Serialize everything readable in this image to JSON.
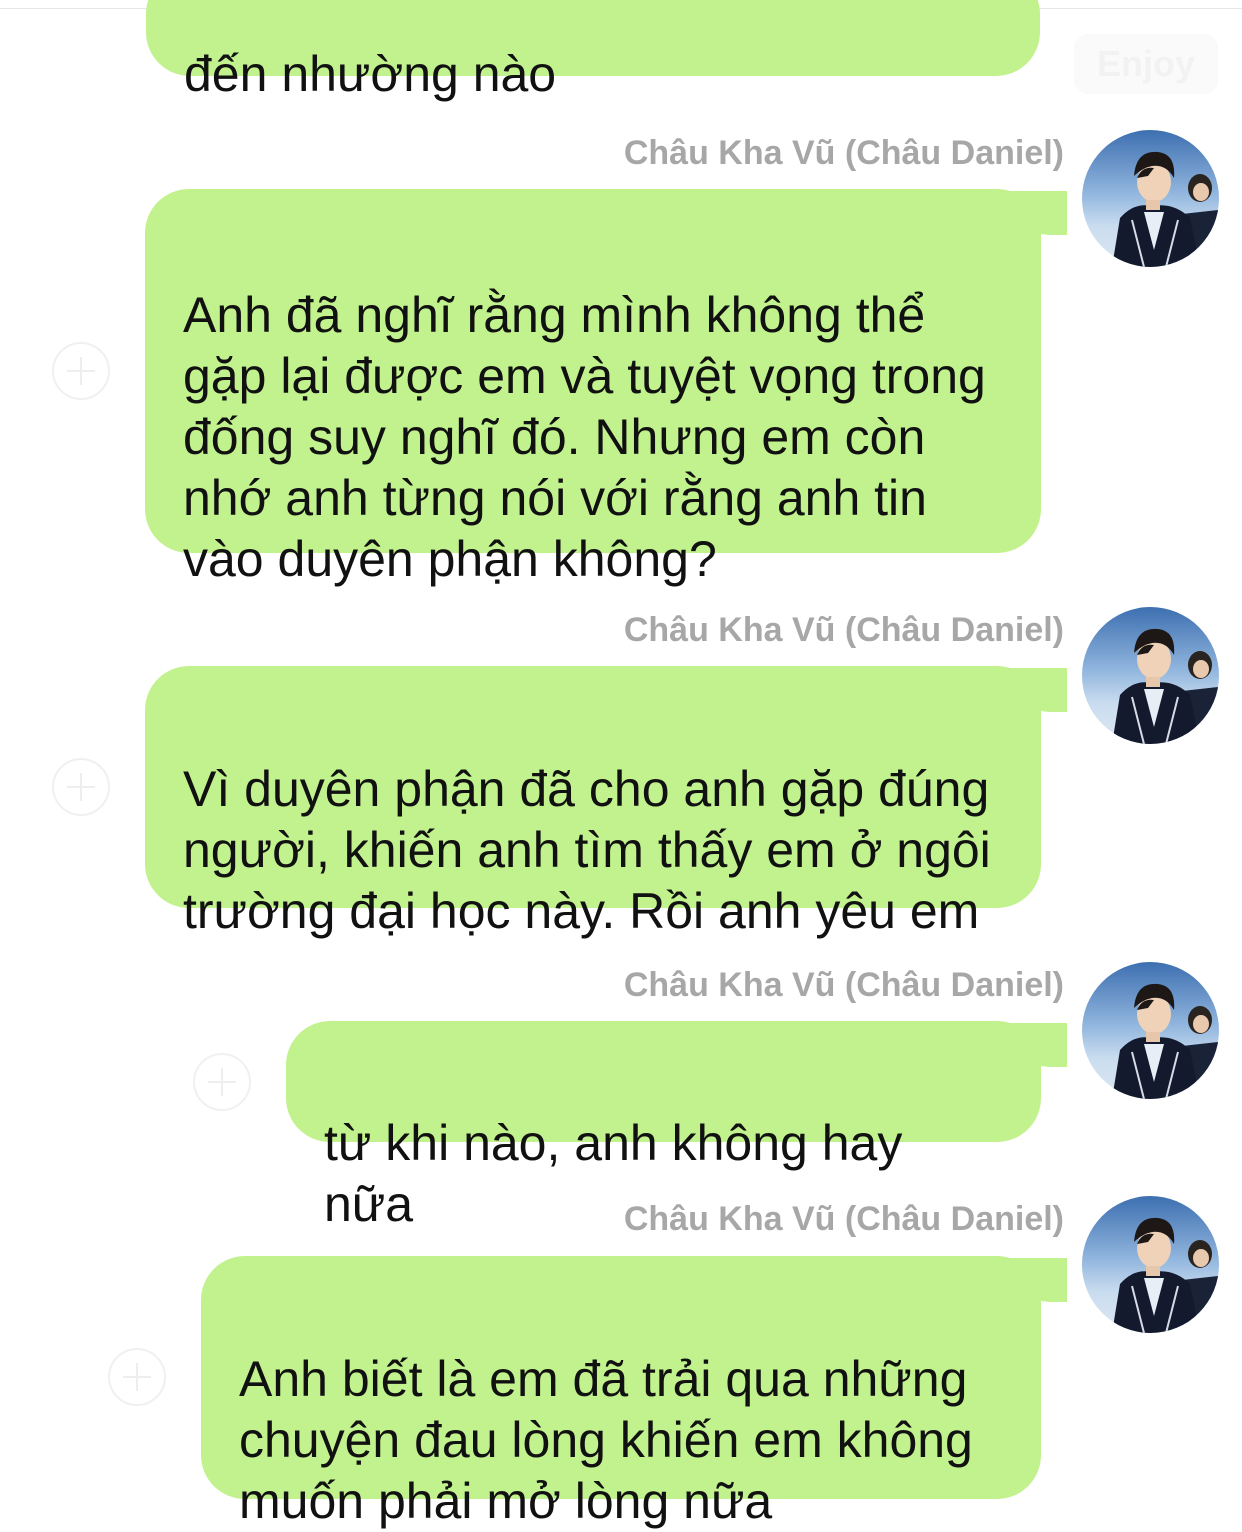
{
  "colors": {
    "bubble": "#c2f28e",
    "sender_name": "#a7a7a7",
    "background": "#ffffff"
  },
  "top_watermark": "Enjoy",
  "messages": [
    {
      "sender": "",
      "text": "đến nhường nào",
      "has_avatar": false
    },
    {
      "sender": "Châu Kha Vũ (Châu Daniel)",
      "text": "Anh đã nghĩ rằng mình không thể\ngặp lại được em và tuyệt vọng trong\nđống suy nghĩ đó. Nhưng em còn\nnhớ anh từng nói với rằng anh tin\nvào duyên phận không?",
      "has_avatar": true,
      "avatar_icon": "avatar-photo"
    },
    {
      "sender": "Châu Kha Vũ (Châu Daniel)",
      "text": "Vì duyên phận đã cho anh gặp đúng\nngười, khiến anh tìm thấy em ở ngôi\ntrường đại học này. Rồi anh yêu em",
      "has_avatar": true,
      "avatar_icon": "avatar-photo"
    },
    {
      "sender": "Châu Kha Vũ (Châu Daniel)",
      "text": "từ khi nào, anh không hay nữa",
      "has_avatar": true,
      "avatar_icon": "avatar-photo"
    },
    {
      "sender": "Châu Kha Vũ (Châu Daniel)",
      "text": "Anh biết là em đã trải qua những\nchuyện đau lòng khiến em không\nmuốn phải mở lòng nữa",
      "has_avatar": true,
      "avatar_icon": "avatar-photo"
    }
  ],
  "reaction_icon": "add-reaction-icon"
}
